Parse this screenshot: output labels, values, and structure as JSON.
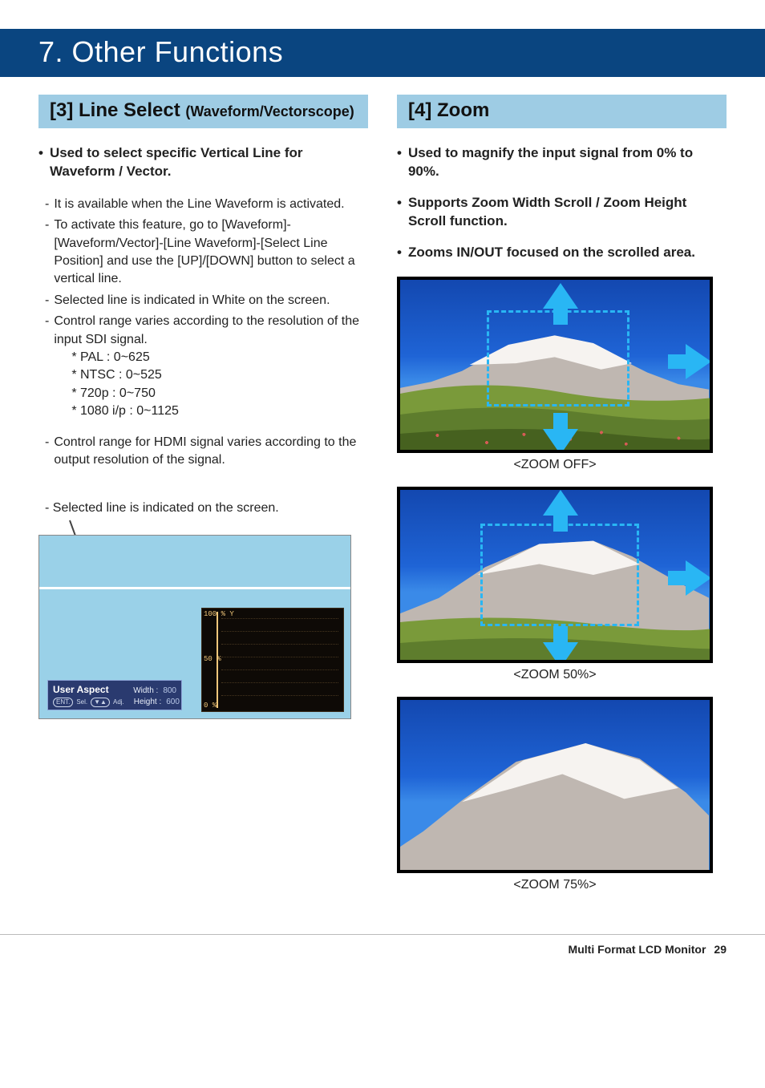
{
  "chapter": {
    "title": "7. Other Functions"
  },
  "left": {
    "heading_main": "[3] Line Select",
    "heading_paren": "(Waveform/Vectorscope)",
    "lead_bullet": "Used to select specific Vertical Line for Waveform / Vector.",
    "sub": [
      "It is available when the Line Waveform is activated.",
      "To activate this feature, go to [Waveform]-[Waveform/Vector]-[Line Waveform]-[Select Line Position] and use the [UP]/[DOWN] button to select a vertical line.",
      "Selected line is indicated in White on the screen.",
      "Control range varies according to the resolution of the input SDI signal."
    ],
    "ranges": [
      "PAL : 0~625",
      "NTSC : 0~525",
      "720p : 0~750",
      "1080 i/p : 0~1125"
    ],
    "hdmi_note": "Control range for HDMI signal varies according to the output resolution of the signal.",
    "screen_caption": "- Selected line is indicated on the screen.",
    "osd": {
      "title": "User Aspect",
      "width_label": "Width :",
      "width_value": "800",
      "height_label": "Height :",
      "height_value": "600",
      "hint_ent": "ENT.",
      "hint_sel": "Sel.",
      "hint_arrows": "▼▲",
      "hint_adj": "Adj."
    },
    "wave_labels": {
      "y100": "100 % Y",
      "y50": "50 %",
      "y0": "0 %"
    }
  },
  "right": {
    "heading": "[4] Zoom",
    "bullets": [
      "Used to magnify the input signal from 0% to 90%.",
      "Supports Zoom Width Scroll / Zoom Height Scroll function.",
      "Zooms IN/OUT focused on the scrolled area."
    ],
    "captions": {
      "off": "<ZOOM OFF>",
      "fifty": "<ZOOM 50%>",
      "seventyfive": "<ZOOM 75%>"
    }
  },
  "footer": {
    "product": "Multi Format LCD Monitor",
    "page": "29"
  }
}
